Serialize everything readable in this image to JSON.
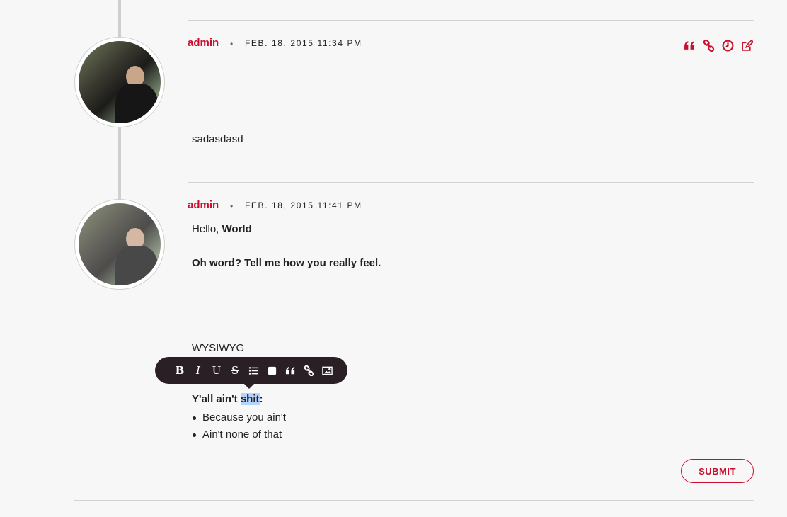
{
  "comments": [
    {
      "author": "admin",
      "timestamp": "FEB. 18, 2015 11:34 PM",
      "body": "sadasdasd",
      "actions": [
        "quote-icon",
        "link-icon",
        "clock-icon",
        "edit-icon"
      ]
    },
    {
      "author": "admin",
      "timestamp": "FEB. 18, 2015 11:41 PM",
      "greeting": "Hello, ",
      "greeting_bold": "World",
      "question": "Oh word? Tell me how you really feel.",
      "wysiwyg": "WYSIWYG",
      "list_heading_a": "Y'all ain't ",
      "list_heading_selected": "shit",
      "list_heading_b": ":",
      "list_items": [
        "Because you ain't",
        "Ain't none of that"
      ]
    }
  ],
  "separator_dot": "•",
  "toolbar": {
    "bold": "B",
    "italic": "I",
    "underline": "U",
    "strike": "S"
  },
  "submit_label": "SUBMIT",
  "colors": {
    "accent": "#c8102e",
    "toolbar_bg": "#2a1f25",
    "selection": "#b3d4fc"
  }
}
